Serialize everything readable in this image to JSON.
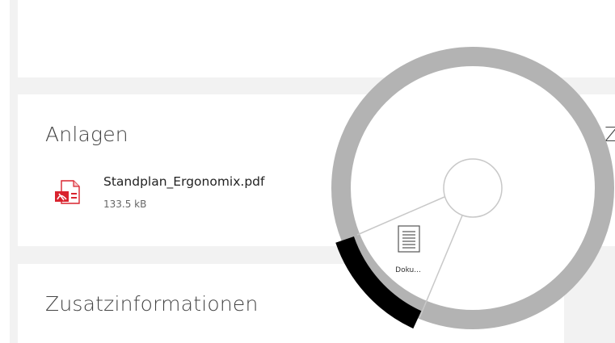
{
  "sections": {
    "attachments": {
      "title": "Anlagen",
      "files": [
        {
          "name": "Standplan_Ergonomix.pdf",
          "size": "133.5 kB",
          "icon": "pdf-file-icon"
        }
      ]
    },
    "additional_info": {
      "title": "Zusatzinformationen"
    },
    "right_column": {
      "title_fragment": "Z"
    }
  },
  "radial_menu": {
    "items": [
      {
        "label": "Doku...",
        "icon": "document-icon",
        "selected": true
      }
    ],
    "colors": {
      "ring": "#b3b3b3",
      "ring_selected": "#000000",
      "center": "#ffffff",
      "divider": "#c8c8c8"
    }
  },
  "colors": {
    "page_background": "#f2f2f2",
    "panel_background": "#ffffff",
    "pdf_red": "#d9232e"
  }
}
